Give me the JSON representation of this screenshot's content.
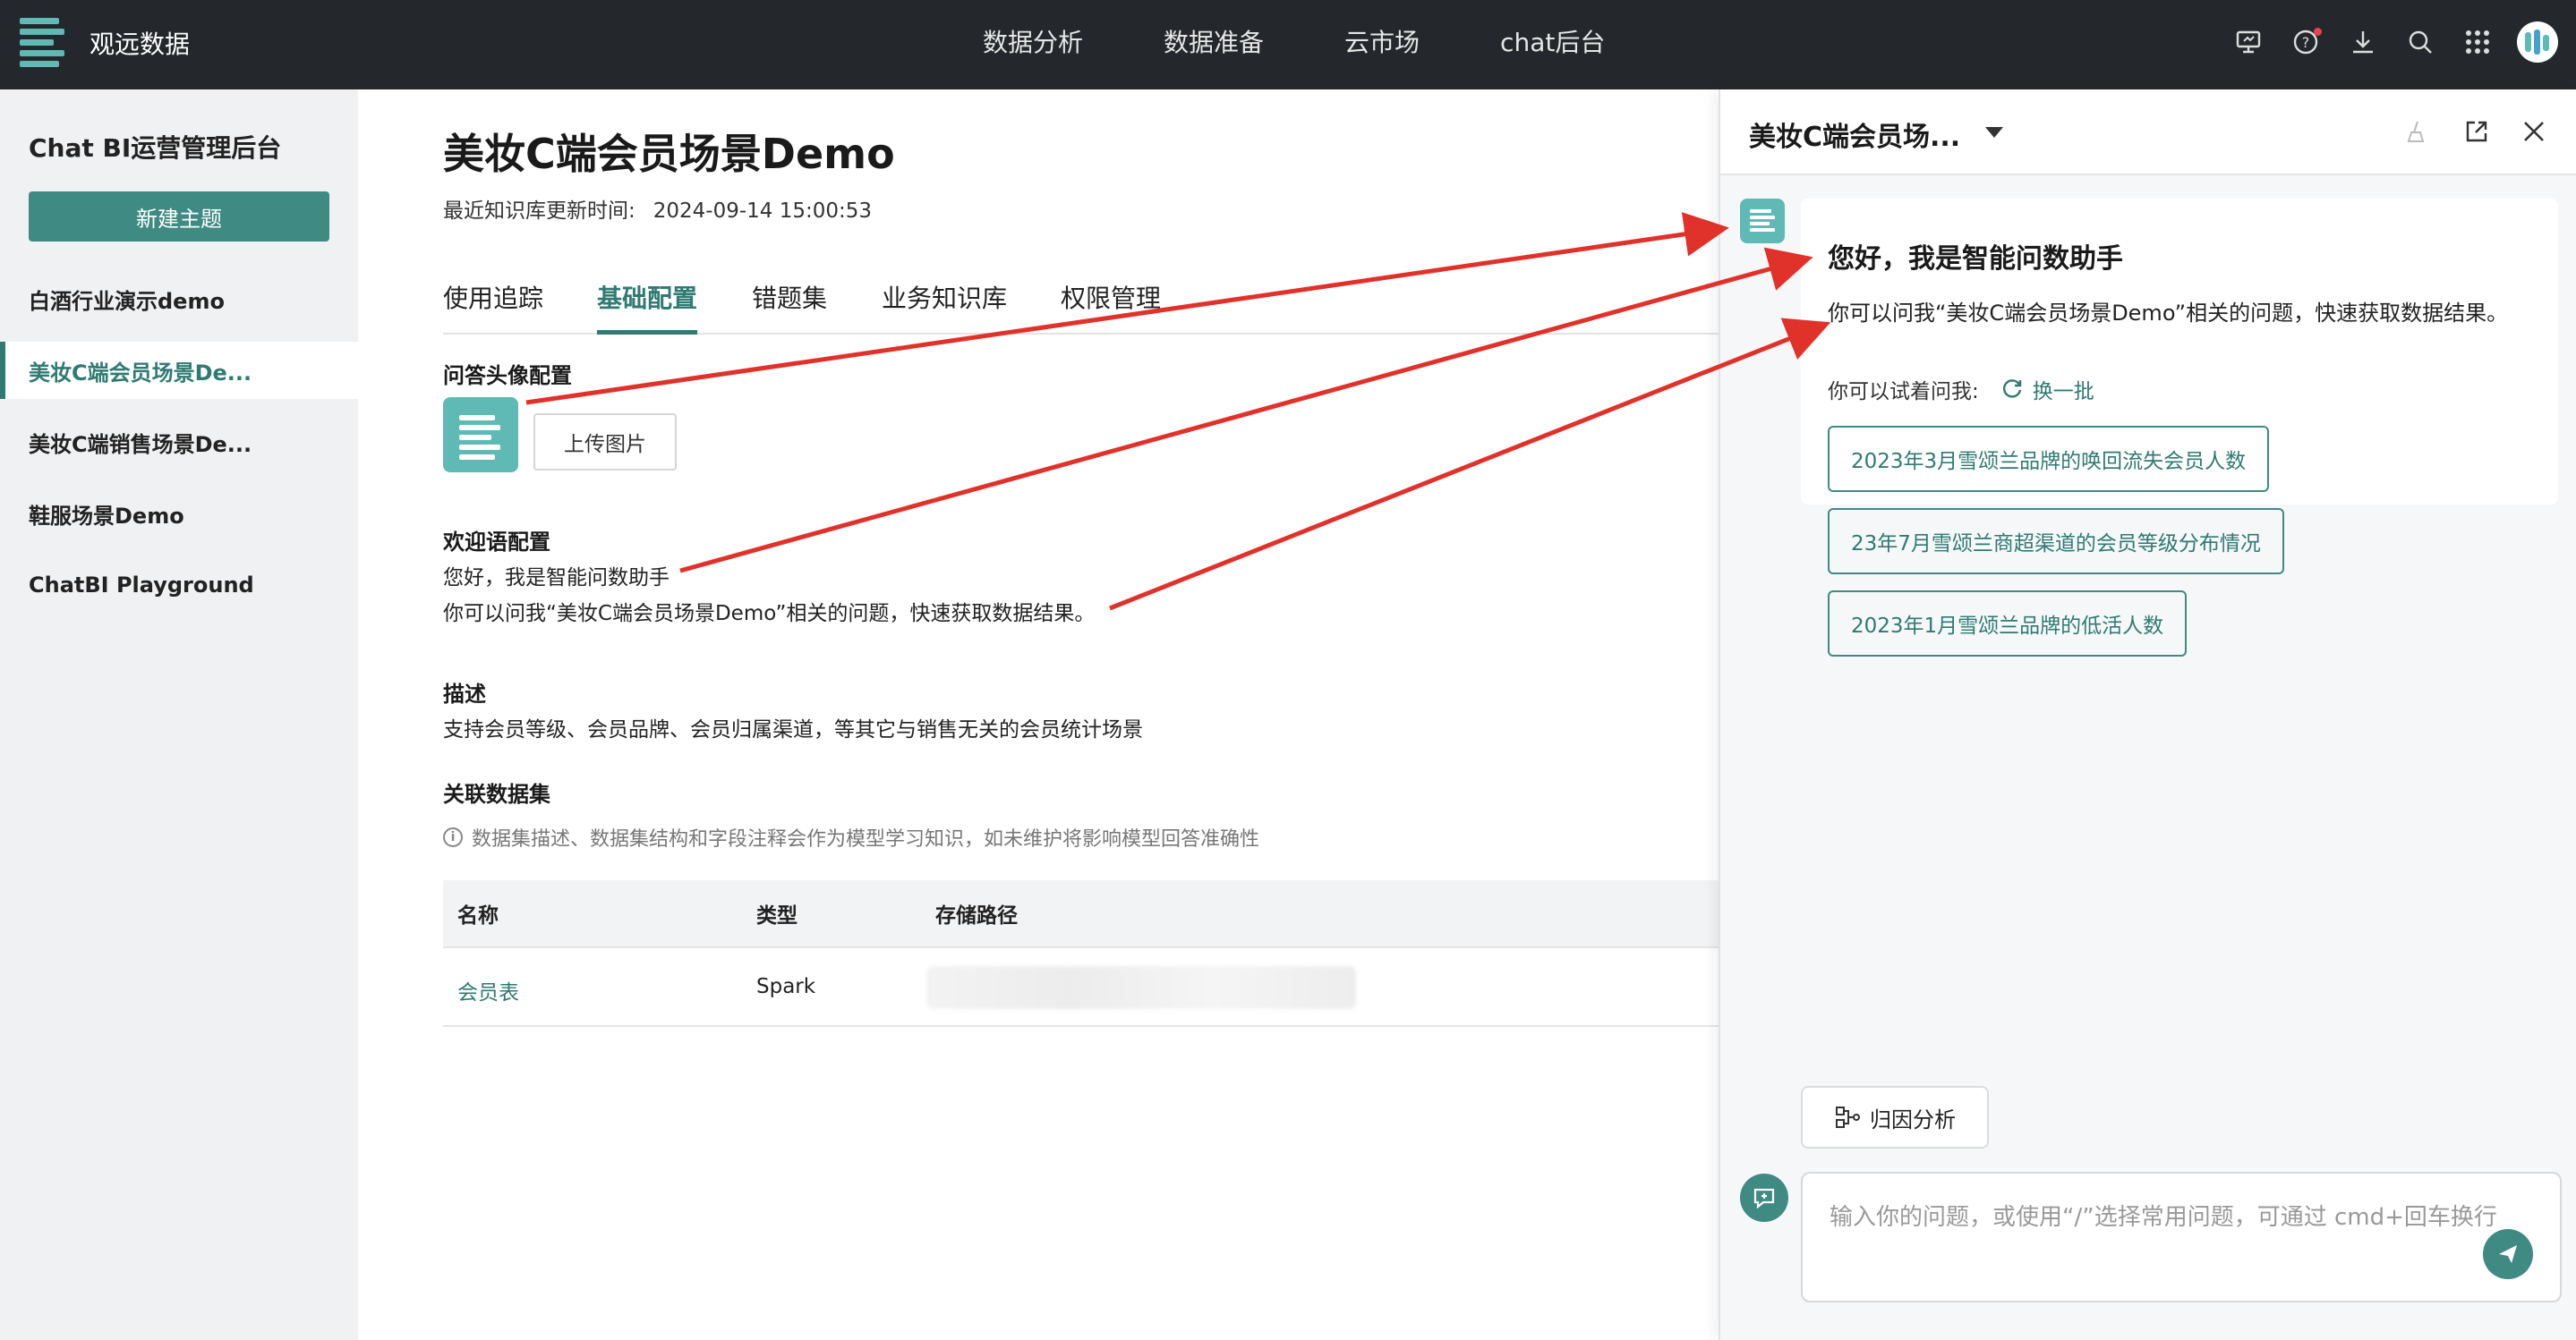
{
  "topbar": {
    "brand": "观远数据",
    "nav": [
      "数据分析",
      "数据准备",
      "云市场",
      "chat后台"
    ],
    "icons": [
      "monitor-icon",
      "help-icon",
      "download-icon",
      "search-icon",
      "apps-grid-icon",
      "user-avatar"
    ]
  },
  "sidebar": {
    "title": "Chat BI运营管理后台",
    "new_button": "新建主题",
    "items": [
      {
        "label": "白酒行业演示demo"
      },
      {
        "label": "美妆C端会员场景De..."
      },
      {
        "label": "美妆C端销售场景De..."
      },
      {
        "label": "鞋服场景Demo"
      },
      {
        "label": "ChatBI Playground"
      }
    ]
  },
  "main": {
    "title": "美妆C端会员场景Demo",
    "updated_label": "最近知识库更新时间:",
    "updated_value": "2024-09-14 15:00:53",
    "tabs": [
      "使用追踪",
      "基础配置",
      "错题集",
      "业务知识库",
      "权限管理"
    ],
    "avatar_section": "问答头像配置",
    "upload_button": "上传图片",
    "welcome_section": "欢迎语配置",
    "welcome_line1": "您好，我是智能问数助手",
    "welcome_line2": "你可以问我“美妆C端会员场景Demo”相关的问题，快速获取数据结果。",
    "desc_section": "描述",
    "desc_text": "支持会员等级、会员品牌、会员归属渠道，等其它与销售无关的会员统计场景",
    "dataset_section": "关联数据集",
    "dataset_note": "数据集描述、数据集结构和字段注释会作为模型学习知识，如未维护将影响模型回答准确性",
    "table": {
      "headers": [
        "名称",
        "类型",
        "存储路径"
      ],
      "rows": [
        {
          "name": "会员表",
          "type": "Spark",
          "path": ""
        }
      ]
    }
  },
  "panel": {
    "title": "美妆C端会员场...",
    "greeting": "您好，我是智能问数助手",
    "intro": "你可以问我“美妆C端会员场景Demo”相关的问题，快速获取数据结果。",
    "try_label": "你可以试着问我:",
    "refresh_label": "换一批",
    "suggestions": [
      "2023年3月雪颂兰品牌的唤回流失会员人数",
      "23年7月雪颂兰商超渠道的会员等级分布情况",
      "2023年1月雪颂兰品牌的低活人数"
    ],
    "attribution_button": "归因分析",
    "input_placeholder": "输入你的问题，或使用“/”选择常用问题，可通过 cmd+回车换行"
  },
  "colors": {
    "accent": "#2f7a72",
    "button": "#3f8a83",
    "logo": "#5fb9b4",
    "topbar": "#24282c",
    "arrow": "#e0322b"
  }
}
